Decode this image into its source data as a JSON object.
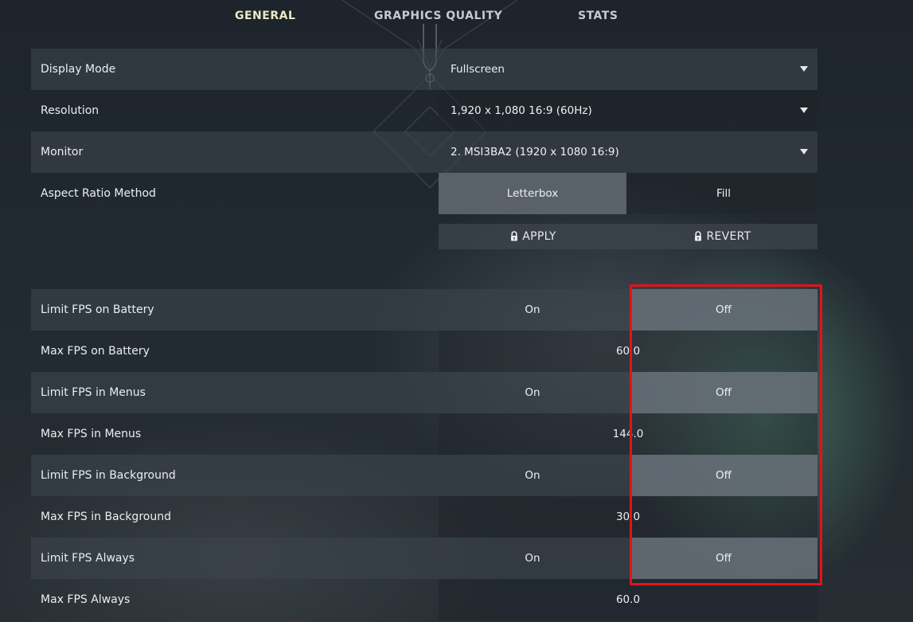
{
  "tabs": [
    {
      "label": "GENERAL",
      "active": true
    },
    {
      "label": "GRAPHICS QUALITY",
      "active": false
    },
    {
      "label": "STATS",
      "active": false
    }
  ],
  "display_settings": [
    {
      "label": "Display Mode",
      "value": "Fullscreen"
    },
    {
      "label": "Resolution",
      "value": "1,920 x 1,080 16:9 (60Hz)"
    },
    {
      "label": "Monitor",
      "value": "2. MSI3BA2 (1920 x  1080 16:9)"
    }
  ],
  "aspect_ratio": {
    "label": "Aspect Ratio Method",
    "options": [
      "Letterbox",
      "Fill"
    ],
    "selected": "Letterbox"
  },
  "actions": {
    "apply": "APPLY",
    "revert": "REVERT"
  },
  "fps_settings": [
    {
      "label": "Limit FPS on Battery",
      "type": "toggle",
      "on": "On",
      "off": "Off",
      "selected": "Off"
    },
    {
      "label": "Max FPS on Battery",
      "type": "value",
      "value": "60.0"
    },
    {
      "label": "Limit FPS in Menus",
      "type": "toggle",
      "on": "On",
      "off": "Off",
      "selected": "Off"
    },
    {
      "label": "Max FPS in Menus",
      "type": "value",
      "value": "144.0"
    },
    {
      "label": "Limit FPS in Background",
      "type": "toggle",
      "on": "On",
      "off": "Off",
      "selected": "Off"
    },
    {
      "label": "Max FPS in Background",
      "type": "value",
      "value": "30.0"
    },
    {
      "label": "Limit FPS Always",
      "type": "toggle",
      "on": "On",
      "off": "Off",
      "selected": "Off"
    },
    {
      "label": "Max FPS Always",
      "type": "value",
      "value": "60.0"
    }
  ],
  "icons": {
    "dropdown": "caret-down-icon",
    "action": "lock-icon"
  },
  "colors": {
    "highlight": "#e3121c",
    "active_tab": "#ece8c4",
    "selected_option": "#6e767e"
  }
}
